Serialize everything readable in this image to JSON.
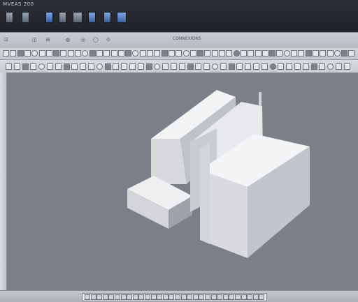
{
  "window": {
    "title": "MVEAS 200"
  },
  "toolbar": {
    "center_label": "CONNEXIONS"
  },
  "icons": {
    "save": "save-icon",
    "open": "open-icon",
    "print": "print-icon"
  }
}
